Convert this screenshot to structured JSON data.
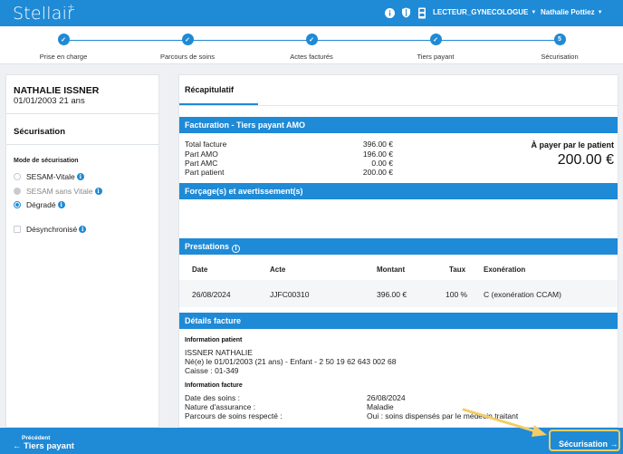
{
  "app": {
    "logo": "Stellair"
  },
  "header": {
    "reader_label": "LECTEUR_GYNECOLOGUE",
    "user_name": "Nathalie Pottiez",
    "icons": [
      "info-icon",
      "shield-icon",
      "card-reader-icon"
    ]
  },
  "stepper": {
    "steps": [
      {
        "label": "Prise en charge",
        "marker": "✓"
      },
      {
        "label": "Parcours de soins",
        "marker": "✓"
      },
      {
        "label": "Actes facturés",
        "marker": "✓"
      },
      {
        "label": "Tiers payant",
        "marker": "✓"
      },
      {
        "label": "Sécurisation",
        "marker": "5"
      }
    ]
  },
  "patient": {
    "name": "NATHALIE ISSNER",
    "dob": "01/01/2003 21 ans"
  },
  "securisation": {
    "title": "Sécurisation",
    "mode_title": "Mode de sécurisation",
    "options": [
      {
        "label": "SESAM-Vitale",
        "state": "unchecked"
      },
      {
        "label": "SESAM sans Vitale",
        "state": "disabled"
      },
      {
        "label": "Dégradé",
        "state": "checked"
      }
    ],
    "desync_label": "Désynchronisé"
  },
  "main": {
    "tab_label": "Récapitulatif",
    "facturation": {
      "header": "Facturation - Tiers payant AMO",
      "rows": [
        {
          "label": "Total facture",
          "value": "396.00 €"
        },
        {
          "label": "Part AMO",
          "value": "196.00 €"
        },
        {
          "label": "Part AMC",
          "value": "0.00 €"
        },
        {
          "label": "Part patient",
          "value": "200.00 €"
        }
      ],
      "pay_label": "À payer par le patient",
      "pay_amount": "200.00 €"
    },
    "forcages": {
      "header": "Forçage(s) et avertissement(s)"
    },
    "prestations": {
      "header": "Prestations",
      "columns": [
        "Date",
        "Acte",
        "Montant",
        "Taux",
        "Exonération"
      ],
      "rows": [
        {
          "date": "26/08/2024",
          "acte": "JJFC00310",
          "montant": "396.00 €",
          "taux": "100 %",
          "exoneration": "C (exonération CCAM)"
        }
      ]
    },
    "details": {
      "header": "Détails facture",
      "patient_title": "Information patient",
      "patient_lines": [
        "ISSNER NATHALIE",
        "Né(e) le 01/01/2003 (21 ans) - Enfant - 2 50 19 62 643 002 68",
        "Caisse : 01-349"
      ],
      "facture_title": "Information facture",
      "facture_rows": [
        {
          "label": "Date des soins :",
          "value": "26/08/2024"
        },
        {
          "label": "Nature d'assurance :",
          "value": "Maladie"
        },
        {
          "label": "Parcours de soins respecté :",
          "value": "Oui : soins dispensés par le médecin traitant"
        }
      ]
    }
  },
  "footer": {
    "prev_small": "Précédent",
    "prev_big": "Tiers payant",
    "next_label": "Sécurisation",
    "highlight_color": "#f3cc65"
  },
  "colors": {
    "primary": "#1f8ad6"
  }
}
